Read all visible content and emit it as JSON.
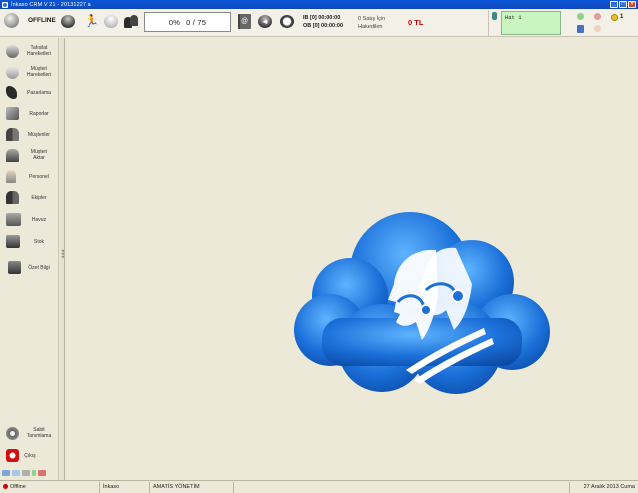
{
  "window": {
    "title": "İnkaso CRM V 21 - 20131227 a"
  },
  "toolbar": {
    "status": "OFFLINE",
    "progress_percent": "0%",
    "progress_count": "0 / 75",
    "timer_ib": "IB [0] 00:00:00",
    "timer_ob": "OB [0] 00:00:00",
    "sales_note_line1": "0 Satış İçin",
    "sales_note_line2": "Hakedilen",
    "total": "0 TL",
    "line_label": "Hat 1",
    "count": "1"
  },
  "sidebar": {
    "items": [
      {
        "label1": "Tahsilat",
        "label2": "Hareketleri",
        "icon": "people-arrows-icon"
      },
      {
        "label1": "Müşteri",
        "label2": "Hareketleri",
        "icon": "chat-bubble-icon"
      },
      {
        "label1": "Pazarlama",
        "label2": "",
        "icon": "phone-icon"
      },
      {
        "label1": "Raporlar",
        "label2": "",
        "icon": "reports-icon"
      },
      {
        "label1": "Müşteriler",
        "label2": "",
        "icon": "customers-icon"
      },
      {
        "label1": "Müşteri",
        "label2": "Aktar",
        "icon": "transfer-icon"
      },
      {
        "label1": "Personel",
        "label2": "",
        "icon": "personnel-icon"
      },
      {
        "label1": "Ekipler",
        "label2": "",
        "icon": "teams-icon"
      },
      {
        "label1": "Havuz",
        "label2": "",
        "icon": "pool-icon"
      },
      {
        "label1": "Stok",
        "label2": "",
        "icon": "stock-icon"
      },
      {
        "label1": "Özet Bilgi",
        "label2": "",
        "icon": "summary-icon"
      }
    ],
    "settings": {
      "label1": "Sabit",
      "label2": "Tanımlama"
    },
    "exit": {
      "label": "Çıkış"
    }
  },
  "statusbar": {
    "connection": "Offline",
    "company": "İnkaso",
    "user": "AMATİS YÖNETİM",
    "date": "27 Aralık 2013 Cuma"
  },
  "colors": {
    "accent": "#0a56d8",
    "total": "#c00000",
    "line_box": "#c9f5c0",
    "logo_blue": "#1f6fd6"
  }
}
